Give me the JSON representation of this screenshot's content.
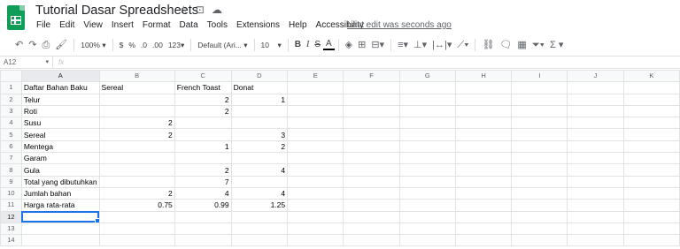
{
  "app": {
    "title": "Tutorial Dasar Spreadsheets",
    "title_icons": [
      "star-icon",
      "move-folder-icon",
      "cloud-status-icon"
    ],
    "last_edit": "Last edit was seconds ago"
  },
  "menu": [
    "File",
    "Edit",
    "View",
    "Insert",
    "Format",
    "Data",
    "Tools",
    "Extensions",
    "Help",
    "Accessibility"
  ],
  "toolbar": {
    "zoom": "100%",
    "currency": "$",
    "percent": "%",
    "decrease_decimal": ".0",
    "increase_decimal": ".00",
    "more_formats": "123",
    "font": "Default (Ari...",
    "font_size": "10",
    "bold": "B",
    "italic": "I",
    "strike": "S",
    "text_color": "A",
    "functions": "Σ"
  },
  "formula_bar": {
    "cell_ref": "A12",
    "fx": "fx",
    "value": ""
  },
  "sheet": {
    "columns": [
      "A",
      "B",
      "C",
      "D",
      "E",
      "F",
      "G",
      "H",
      "I",
      "J",
      "K"
    ],
    "selected_cell": "A12",
    "rows": [
      [
        "Daftar Bahan Baku",
        "Sereal",
        "French Toast",
        "Donat",
        "",
        "",
        "",
        "",
        "",
        "",
        ""
      ],
      [
        "Telur",
        "",
        "2",
        "1",
        "",
        "",
        "",
        "",
        "",
        "",
        ""
      ],
      [
        "Roti",
        "",
        "2",
        "",
        "",
        "",
        "",
        "",
        "",
        "",
        ""
      ],
      [
        "Susu",
        "2",
        "",
        "",
        "",
        "",
        "",
        "",
        "",
        "",
        ""
      ],
      [
        "Sereal",
        "2",
        "",
        "3",
        "",
        "",
        "",
        "",
        "",
        "",
        ""
      ],
      [
        "Mentega",
        "",
        "1",
        "2",
        "",
        "",
        "",
        "",
        "",
        "",
        ""
      ],
      [
        "Garam",
        "",
        "",
        "",
        "",
        "",
        "",
        "",
        "",
        "",
        ""
      ],
      [
        "Gula",
        "",
        "2",
        "4",
        "",
        "",
        "",
        "",
        "",
        "",
        ""
      ],
      [
        "Total yang dibutuhkan",
        "",
        "7",
        "",
        "",
        "",
        "",
        "",
        "",
        "",
        ""
      ],
      [
        "Jumlah bahan",
        "2",
        "4",
        "4",
        "",
        "",
        "",
        "",
        "",
        "",
        ""
      ],
      [
        "Harga rata-rata",
        "0.75",
        "0.99",
        "1.25",
        "",
        "",
        "",
        "",
        "",
        "",
        ""
      ],
      [
        "",
        "",
        "",
        "",
        "",
        "",
        "",
        "",
        "",
        "",
        ""
      ],
      [
        "",
        "",
        "",
        "",
        "",
        "",
        "",
        "",
        "",
        "",
        ""
      ],
      [
        "",
        "",
        "",
        "",
        "",
        "",
        "",
        "",
        "",
        "",
        ""
      ]
    ]
  },
  "colors": {
    "brand_green": "#0f9d58",
    "selection_blue": "#1a73e8"
  }
}
